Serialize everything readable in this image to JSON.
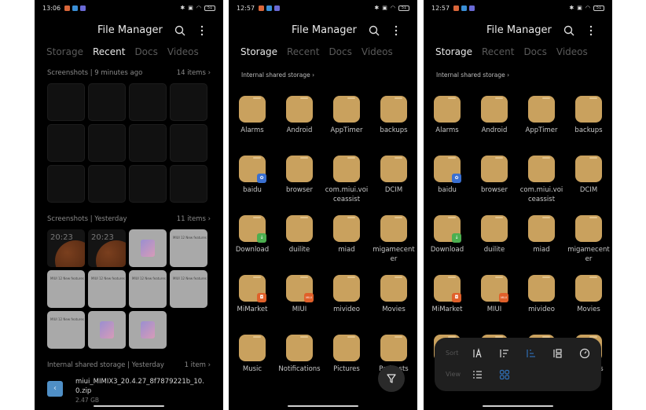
{
  "app": {
    "title": "File Manager"
  },
  "tabs": [
    "Storage",
    "Recent",
    "Docs",
    "Videos"
  ],
  "colors": {
    "background": "#000000",
    "folder": "#c9a15e",
    "accent_blue": "#2f6fb6",
    "tab_inactive": "#5a5a5a",
    "tab_active": "#e8e8e8"
  },
  "screens": [
    {
      "status": {
        "time": "13:06",
        "battery": "51"
      },
      "active_tab": "Recent",
      "sections": [
        {
          "title": "Screenshots | 9 minutes ago",
          "count": "14 items"
        },
        {
          "title": "Screenshots | Yesterday",
          "count": "11 items"
        },
        {
          "title": "Internal shared storage | Yesterday",
          "count": "1 item"
        }
      ],
      "thumb_labels": [
        "20:23",
        "20:23",
        "",
        "MIUI 12 New features",
        "MIUI 12 New features",
        "MIUI 12 New features",
        "MIUI 12 New features",
        "MIUI 12 New features",
        "MIUI 12 New features",
        "",
        ""
      ],
      "file": {
        "name": "miui_MIMIX3_20.4.27_8f7879221b_10.0.zip",
        "size": "2.47 GB",
        "icon": "zip-icon"
      }
    },
    {
      "status": {
        "time": "12:57",
        "battery": "51"
      },
      "active_tab": "Storage",
      "breadcrumb": "Internal shared storage"
    },
    {
      "status": {
        "time": "12:57",
        "battery": "51"
      },
      "active_tab": "Storage",
      "breadcrumb": "Internal shared storage",
      "sort_panel": {
        "sort_label": "Sort",
        "view_label": "View",
        "sort_options": [
          "sort-by-name",
          "sort-by-date",
          "sort-by-size-selected",
          "sort-by-type",
          "sort-by-time"
        ],
        "view_options": [
          "list-view",
          "grid-view-selected"
        ]
      }
    }
  ],
  "folders": [
    {
      "name": "Alarms"
    },
    {
      "name": "Android"
    },
    {
      "name": "AppTimer"
    },
    {
      "name": "backups"
    },
    {
      "name": "baidu",
      "badge": "paw-icon",
      "badge_color": "#3a6fd0"
    },
    {
      "name": "browser"
    },
    {
      "name": "com.miui.voiceassist"
    },
    {
      "name": "DCIM"
    },
    {
      "name": "Download",
      "badge": "download-arrow-icon",
      "badge_color": "#4caf50"
    },
    {
      "name": "duilite"
    },
    {
      "name": "miad"
    },
    {
      "name": "migamecenter"
    },
    {
      "name": "MiMarket",
      "badge": "bag-icon",
      "badge_color": "#e0602a"
    },
    {
      "name": "MIUI",
      "badge": "miui-icon",
      "badge_color": "#e0602a",
      "badge_text": "MIUI"
    },
    {
      "name": "mivideo"
    },
    {
      "name": "Movies"
    },
    {
      "name": "Music"
    },
    {
      "name": "Notifications"
    },
    {
      "name": "Pictures"
    },
    {
      "name": "Podcasts"
    }
  ]
}
